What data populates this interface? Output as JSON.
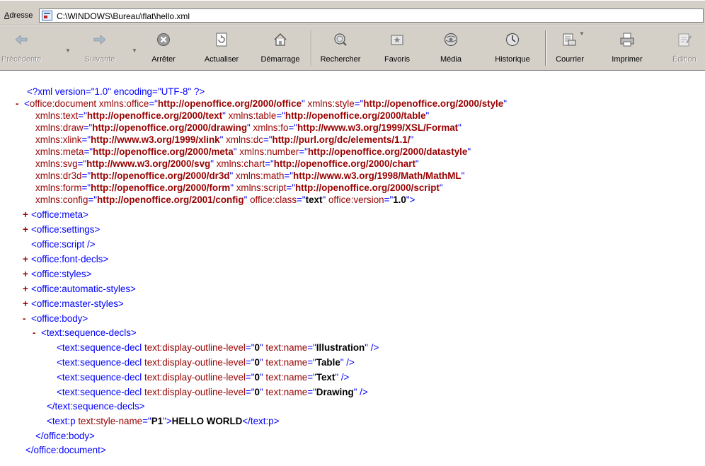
{
  "address": {
    "label_underlined": "A",
    "label_rest": "dresse",
    "url": "C:\\WINDOWS\\Bureau\\flat\\hello.xml"
  },
  "toolbar": {
    "back": "Précédente",
    "forward": "Suivante",
    "stop": "Arrêter",
    "refresh": "Actualiser",
    "home": "Démarrage",
    "search": "Rechercher",
    "favorites": "Favoris",
    "media": "Média",
    "history": "Historique",
    "mail": "Courrier",
    "print": "Imprimer",
    "edit": "Édition"
  },
  "xml": {
    "pi": "<?xml version=\"1.0\" encoding=\"UTF-8\" ?>",
    "doc_open": "<office:document",
    "ns": [
      {
        "name": "xmlns:office",
        "value": "http://openoffice.org/2000/office"
      },
      {
        "name": "xmlns:style",
        "value": "http://openoffice.org/2000/style"
      },
      {
        "name": "xmlns:text",
        "value": "http://openoffice.org/2000/text"
      },
      {
        "name": "xmlns:table",
        "value": "http://openoffice.org/2000/table"
      },
      {
        "name": "xmlns:draw",
        "value": "http://openoffice.org/2000/drawing"
      },
      {
        "name": "xmlns:fo",
        "value": "http://www.w3.org/1999/XSL/Format"
      },
      {
        "name": "xmlns:xlink",
        "value": "http://www.w3.org/1999/xlink"
      },
      {
        "name": "xmlns:dc",
        "value": "http://purl.org/dc/elements/1.1/"
      },
      {
        "name": "xmlns:meta",
        "value": "http://openoffice.org/2000/meta"
      },
      {
        "name": "xmlns:number",
        "value": "http://openoffice.org/2000/datastyle"
      },
      {
        "name": "xmlns:svg",
        "value": "http://www.w3.org/2000/svg"
      },
      {
        "name": "xmlns:chart",
        "value": "http://openoffice.org/2000/chart"
      },
      {
        "name": "xmlns:dr3d",
        "value": "http://openoffice.org/2000/dr3d"
      },
      {
        "name": "xmlns:math",
        "value": "http://www.w3.org/1998/Math/MathML"
      },
      {
        "name": "xmlns:form",
        "value": "http://openoffice.org/2000/form"
      },
      {
        "name": "xmlns:script",
        "value": "http://openoffice.org/2000/script"
      },
      {
        "name": "xmlns:config",
        "value": "http://openoffice.org/2001/config"
      },
      {
        "name": "office:class",
        "value": "text"
      },
      {
        "name": "office:version",
        "value": "1.0"
      }
    ],
    "doc_gt": ">",
    "collapsed": [
      {
        "marker": "+",
        "tag": "<office:meta>"
      },
      {
        "marker": "+",
        "tag": "<office:settings>"
      },
      {
        "marker": "",
        "tag": "<office:script />"
      },
      {
        "marker": "+",
        "tag": "<office:font-decls>"
      },
      {
        "marker": "+",
        "tag": "<office:styles>"
      },
      {
        "marker": "+",
        "tag": "<office:automatic-styles>"
      },
      {
        "marker": "+",
        "tag": "<office:master-styles>"
      }
    ],
    "body_open": "<office:body>",
    "seq_open": "<text:sequence-decls>",
    "seq_decl_open": "<text:sequence-decl",
    "attr_level": "text:display-outline-level",
    "attr_name": "text:name",
    "level_value": "0",
    "seq_names": [
      "Illustration",
      "Table",
      "Text",
      "Drawing"
    ],
    "self_close": " />",
    "seq_close": "</text:sequence-decls>",
    "p_open": "<text:p",
    "p_attr": "text:style-name",
    "p_style": "P1",
    "p_text": "HELLO WORLD",
    "p_close": "</text:p>",
    "body_close": "</office:body>",
    "doc_close": "</office:document>",
    "minus": "-"
  },
  "colors": {
    "markup": "#0000ff",
    "name": "#990000",
    "text": "#000000",
    "chrome": "#d4d0c8"
  }
}
